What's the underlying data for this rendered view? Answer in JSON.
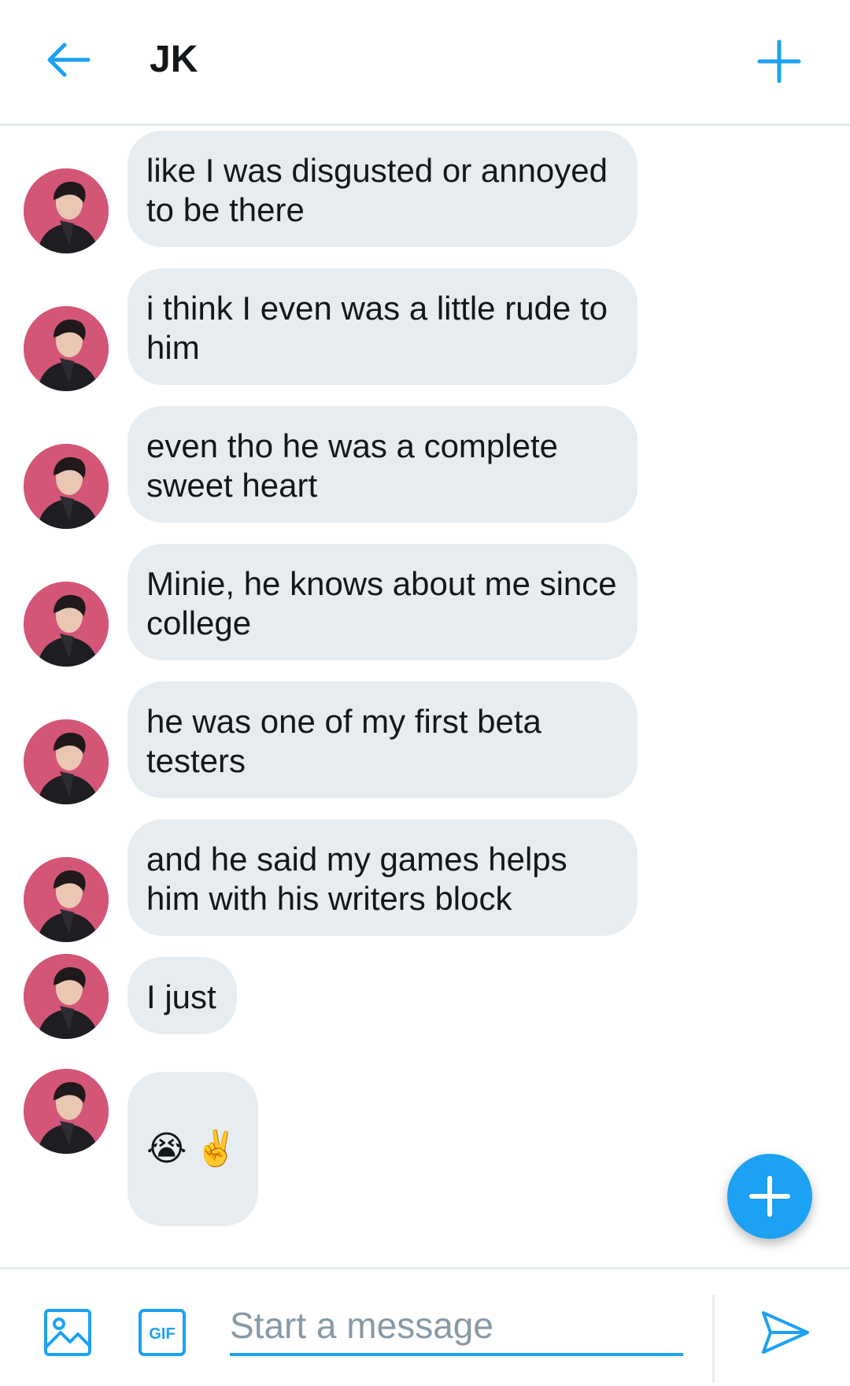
{
  "header": {
    "title": "JK",
    "back_icon": "arrow-left-icon",
    "plus_icon": "plus-icon"
  },
  "messages": [
    {
      "text": "like I was disgusted or annoyed\nto be there"
    },
    {
      "text": "i think I even was a little rude to\nhim"
    },
    {
      "text": "even tho he was a complete\nsweet heart"
    },
    {
      "text": "Minie, he knows about me since\ncollege"
    },
    {
      "text": "he was one of my first beta\ntesters"
    },
    {
      "text": "and he said my games helps\nhim with his writers block"
    },
    {
      "text": "I just"
    },
    {
      "emojis": [
        "😭",
        "✌️"
      ]
    }
  ],
  "composer": {
    "placeholder": "Start a message",
    "gif_label": "GIF"
  },
  "colors": {
    "accent": "#1da1f2",
    "bubble": "#e6ecf0",
    "avatar_bg": "#d35677"
  }
}
